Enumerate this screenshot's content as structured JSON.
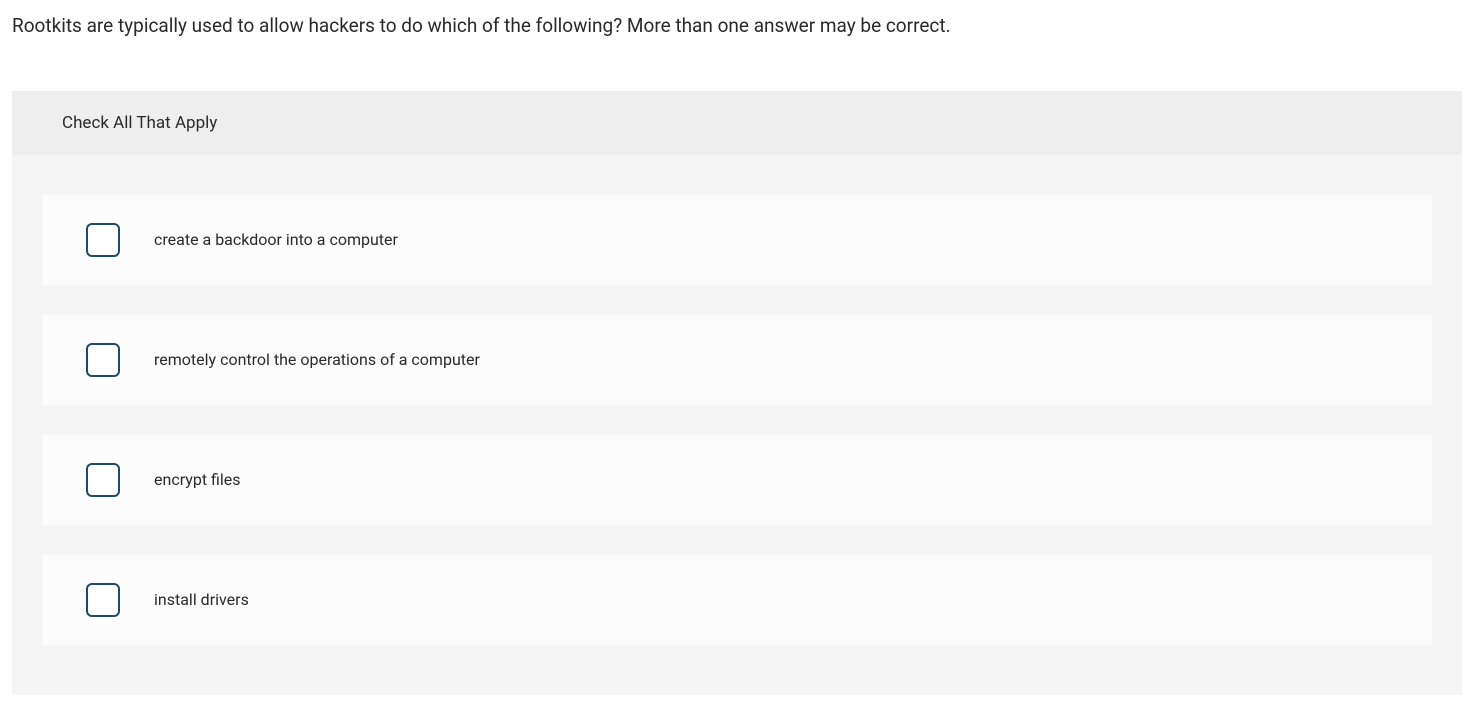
{
  "question": {
    "text": "Rootkits are typically used to allow hackers to do which of the following? More than one answer may be correct."
  },
  "instruction": "Check All That Apply",
  "options": [
    {
      "label": "create a backdoor into a computer"
    },
    {
      "label": "remotely control the operations of a computer"
    },
    {
      "label": "encrypt files"
    },
    {
      "label": "install drivers"
    }
  ]
}
